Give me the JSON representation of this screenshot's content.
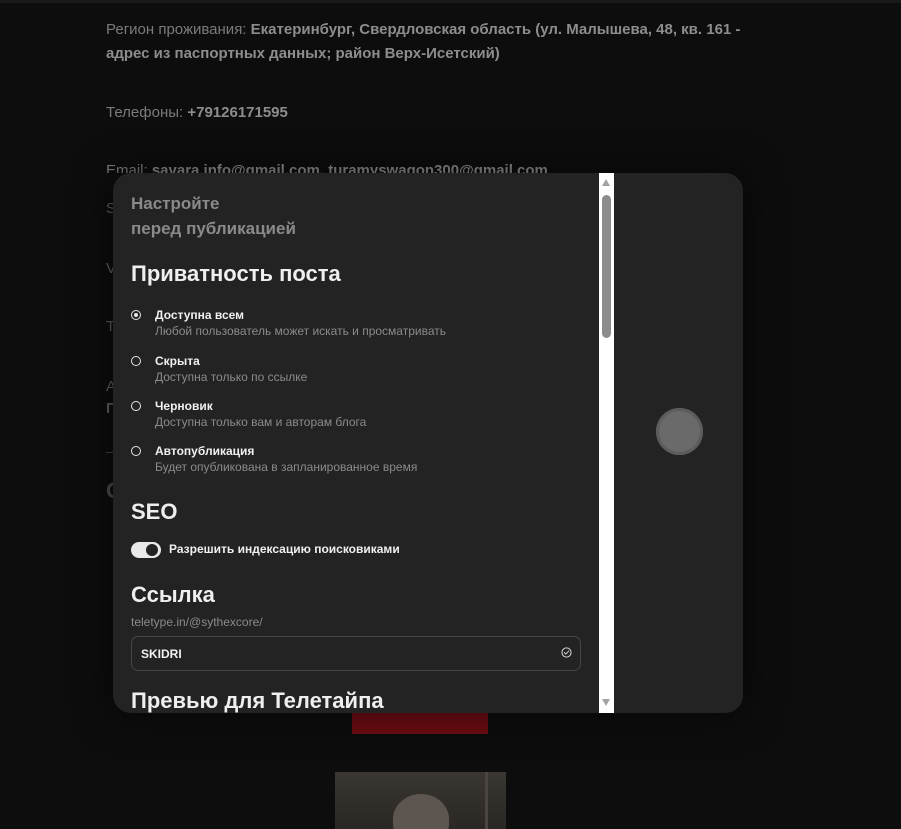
{
  "background_article": {
    "region_label": "Регион проживания: ",
    "region_value": "Екатеринбург, Свердловская область (ул. Малышева, 48, кв. 161 - адрес из паспортных данных; район Верх-Исетский)",
    "phones_label": "Телефоны: ",
    "phones_value": "+79126171595",
    "email_label": "Email: ",
    "email_value": "savara.info@gmail.com, turamyswagon300@gmail.com",
    "frag_s": "S",
    "frag_v": "V",
    "frag_t": "T",
    "frag_a": "A",
    "frag_p": "П",
    "frag_c": "С"
  },
  "modal": {
    "subtitle_line1": "Настройте",
    "subtitle_line2": "перед публикацией",
    "privacy": {
      "heading": "Приватность поста",
      "options": [
        {
          "label": "Доступна всем",
          "description": "Любой пользователь может искать и просматривать",
          "selected": true
        },
        {
          "label": "Скрыта",
          "description": "Доступна только по ссылке",
          "selected": false
        },
        {
          "label": "Черновик",
          "description": "Доступна только вам и авторам блога",
          "selected": false
        },
        {
          "label": "Автопубликация",
          "description": "Будет опубликована в запланированное время",
          "selected": false
        }
      ]
    },
    "seo": {
      "heading": "SEO",
      "toggle_label": "Разрешить индексацию поисковиками",
      "toggle_on": true
    },
    "link": {
      "heading": "Ссылка",
      "prefix": "teletype.in/@sythexcore/",
      "slug_value": "SKIDRI"
    },
    "preview_heading": "Превью для Телетайпа"
  },
  "colors": {
    "page_bg": "#0d0d0e",
    "modal_bg": "#232324",
    "text_primary": "#efefef",
    "text_muted": "#8b8b8b",
    "accent_red": "#6e0d13"
  }
}
